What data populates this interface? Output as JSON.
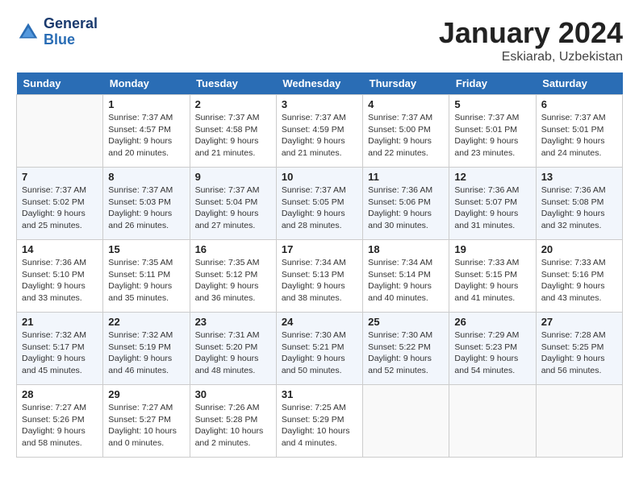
{
  "logo": {
    "line1": "General",
    "line2": "Blue"
  },
  "title": "January 2024",
  "location": "Eskiarab, Uzbekistan",
  "days_of_week": [
    "Sunday",
    "Monday",
    "Tuesday",
    "Wednesday",
    "Thursday",
    "Friday",
    "Saturday"
  ],
  "weeks": [
    [
      {
        "day": "",
        "info": ""
      },
      {
        "day": "1",
        "info": "Sunrise: 7:37 AM\nSunset: 4:57 PM\nDaylight: 9 hours\nand 20 minutes."
      },
      {
        "day": "2",
        "info": "Sunrise: 7:37 AM\nSunset: 4:58 PM\nDaylight: 9 hours\nand 21 minutes."
      },
      {
        "day": "3",
        "info": "Sunrise: 7:37 AM\nSunset: 4:59 PM\nDaylight: 9 hours\nand 21 minutes."
      },
      {
        "day": "4",
        "info": "Sunrise: 7:37 AM\nSunset: 5:00 PM\nDaylight: 9 hours\nand 22 minutes."
      },
      {
        "day": "5",
        "info": "Sunrise: 7:37 AM\nSunset: 5:01 PM\nDaylight: 9 hours\nand 23 minutes."
      },
      {
        "day": "6",
        "info": "Sunrise: 7:37 AM\nSunset: 5:01 PM\nDaylight: 9 hours\nand 24 minutes."
      }
    ],
    [
      {
        "day": "7",
        "info": "Sunrise: 7:37 AM\nSunset: 5:02 PM\nDaylight: 9 hours\nand 25 minutes."
      },
      {
        "day": "8",
        "info": "Sunrise: 7:37 AM\nSunset: 5:03 PM\nDaylight: 9 hours\nand 26 minutes."
      },
      {
        "day": "9",
        "info": "Sunrise: 7:37 AM\nSunset: 5:04 PM\nDaylight: 9 hours\nand 27 minutes."
      },
      {
        "day": "10",
        "info": "Sunrise: 7:37 AM\nSunset: 5:05 PM\nDaylight: 9 hours\nand 28 minutes."
      },
      {
        "day": "11",
        "info": "Sunrise: 7:36 AM\nSunset: 5:06 PM\nDaylight: 9 hours\nand 30 minutes."
      },
      {
        "day": "12",
        "info": "Sunrise: 7:36 AM\nSunset: 5:07 PM\nDaylight: 9 hours\nand 31 minutes."
      },
      {
        "day": "13",
        "info": "Sunrise: 7:36 AM\nSunset: 5:08 PM\nDaylight: 9 hours\nand 32 minutes."
      }
    ],
    [
      {
        "day": "14",
        "info": "Sunrise: 7:36 AM\nSunset: 5:10 PM\nDaylight: 9 hours\nand 33 minutes."
      },
      {
        "day": "15",
        "info": "Sunrise: 7:35 AM\nSunset: 5:11 PM\nDaylight: 9 hours\nand 35 minutes."
      },
      {
        "day": "16",
        "info": "Sunrise: 7:35 AM\nSunset: 5:12 PM\nDaylight: 9 hours\nand 36 minutes."
      },
      {
        "day": "17",
        "info": "Sunrise: 7:34 AM\nSunset: 5:13 PM\nDaylight: 9 hours\nand 38 minutes."
      },
      {
        "day": "18",
        "info": "Sunrise: 7:34 AM\nSunset: 5:14 PM\nDaylight: 9 hours\nand 40 minutes."
      },
      {
        "day": "19",
        "info": "Sunrise: 7:33 AM\nSunset: 5:15 PM\nDaylight: 9 hours\nand 41 minutes."
      },
      {
        "day": "20",
        "info": "Sunrise: 7:33 AM\nSunset: 5:16 PM\nDaylight: 9 hours\nand 43 minutes."
      }
    ],
    [
      {
        "day": "21",
        "info": "Sunrise: 7:32 AM\nSunset: 5:17 PM\nDaylight: 9 hours\nand 45 minutes."
      },
      {
        "day": "22",
        "info": "Sunrise: 7:32 AM\nSunset: 5:19 PM\nDaylight: 9 hours\nand 46 minutes."
      },
      {
        "day": "23",
        "info": "Sunrise: 7:31 AM\nSunset: 5:20 PM\nDaylight: 9 hours\nand 48 minutes."
      },
      {
        "day": "24",
        "info": "Sunrise: 7:30 AM\nSunset: 5:21 PM\nDaylight: 9 hours\nand 50 minutes."
      },
      {
        "day": "25",
        "info": "Sunrise: 7:30 AM\nSunset: 5:22 PM\nDaylight: 9 hours\nand 52 minutes."
      },
      {
        "day": "26",
        "info": "Sunrise: 7:29 AM\nSunset: 5:23 PM\nDaylight: 9 hours\nand 54 minutes."
      },
      {
        "day": "27",
        "info": "Sunrise: 7:28 AM\nSunset: 5:25 PM\nDaylight: 9 hours\nand 56 minutes."
      }
    ],
    [
      {
        "day": "28",
        "info": "Sunrise: 7:27 AM\nSunset: 5:26 PM\nDaylight: 9 hours\nand 58 minutes."
      },
      {
        "day": "29",
        "info": "Sunrise: 7:27 AM\nSunset: 5:27 PM\nDaylight: 10 hours\nand 0 minutes."
      },
      {
        "day": "30",
        "info": "Sunrise: 7:26 AM\nSunset: 5:28 PM\nDaylight: 10 hours\nand 2 minutes."
      },
      {
        "day": "31",
        "info": "Sunrise: 7:25 AM\nSunset: 5:29 PM\nDaylight: 10 hours\nand 4 minutes."
      },
      {
        "day": "",
        "info": ""
      },
      {
        "day": "",
        "info": ""
      },
      {
        "day": "",
        "info": ""
      }
    ]
  ]
}
